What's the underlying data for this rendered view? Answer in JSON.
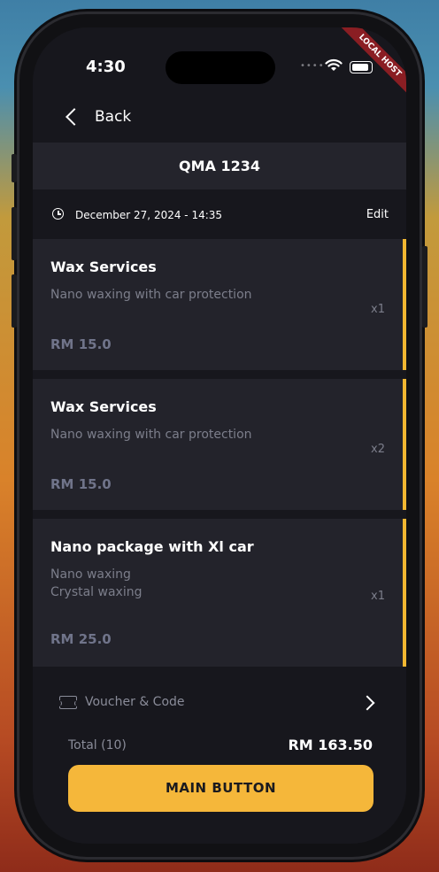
{
  "status": {
    "time": "4:30",
    "ribbon": "LOCAL HOST"
  },
  "nav": {
    "back_label": "Back"
  },
  "plate": "QMA 1234",
  "booking": {
    "datetime": "December 27, 2024 - 14:35",
    "edit_label": "Edit"
  },
  "items": [
    {
      "title": "Wax Services",
      "desc_lines": [
        "Nano waxing with car protection"
      ],
      "qty": "x1",
      "price": "RM 15.0"
    },
    {
      "title": "Wax Services",
      "desc_lines": [
        "Nano waxing with car protection"
      ],
      "qty": "x2",
      "price": "RM 15.0"
    },
    {
      "title": "Nano package with Xl car",
      "desc_lines": [
        "Nano waxing",
        "Crystal waxing"
      ],
      "qty": "x1",
      "price": "RM 25.0"
    }
  ],
  "voucher": {
    "label": "Voucher & Code"
  },
  "summary": {
    "total_label": "Total (10)",
    "total_value": "RM 163.50"
  },
  "main_button": {
    "label": "MAIN BUTTON"
  },
  "colors": {
    "accent": "#f5b73a",
    "card_bg": "#23232b",
    "screen_bg": "#17171d",
    "muted_text": "#7c7e8b"
  }
}
